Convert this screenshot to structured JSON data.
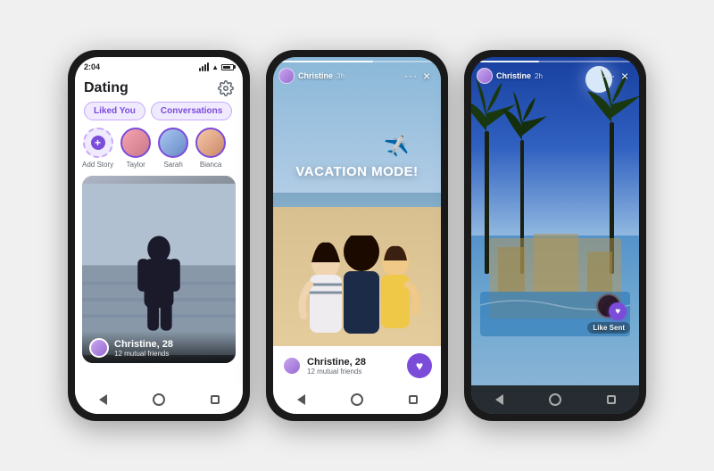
{
  "page": {
    "background": "#f0f0f0"
  },
  "phone1": {
    "status": {
      "time": "2:04",
      "signal_bars": [
        1,
        1,
        1,
        1
      ],
      "wifi": "wifi",
      "battery": "70"
    },
    "header": {
      "title": "Dating",
      "gear_label": "Settings"
    },
    "tabs": {
      "liked_you": "Liked You",
      "conversations": "Conversations"
    },
    "stories": [
      {
        "name": "Add Story",
        "type": "add"
      },
      {
        "name": "Taylor",
        "type": "story"
      },
      {
        "name": "Sarah",
        "type": "story"
      },
      {
        "name": "Bianca",
        "type": "story"
      }
    ],
    "profile": {
      "name": "Christine, 28",
      "mutual_friends": "12 mutual friends"
    },
    "nav": {
      "back": "back",
      "home": "home",
      "recents": "recents"
    }
  },
  "phone2": {
    "status": {
      "username": "Christine",
      "time_ago": "3h",
      "close": "×",
      "more": "···"
    },
    "story": {
      "text": "VACATION MODE!",
      "plane_emoji": "✈️"
    },
    "profile": {
      "name": "Christine, 28",
      "mutual_friends": "12 mutual friends",
      "heart_label": "Like"
    }
  },
  "phone3": {
    "status": {
      "username": "Christine",
      "time_ago": "2h",
      "close": "×",
      "more": "···"
    },
    "like_sent": {
      "label": "Like Sent"
    }
  }
}
